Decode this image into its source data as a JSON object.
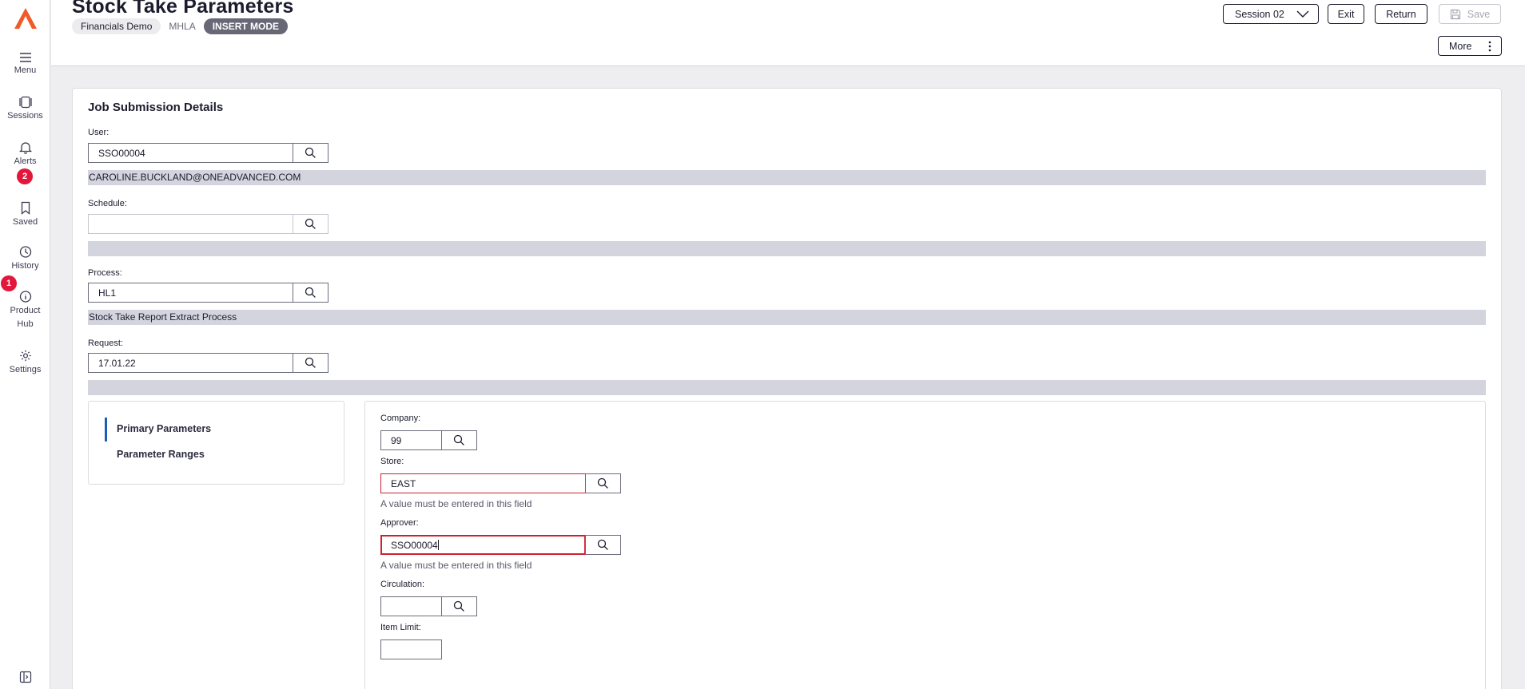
{
  "rail": {
    "items": [
      {
        "label": "Menu",
        "icon": "hamburger-icon"
      },
      {
        "label": "Sessions",
        "icon": "sessions-icon"
      },
      {
        "label": "Alerts",
        "icon": "bell-icon",
        "badge": "2"
      },
      {
        "label": "Saved",
        "icon": "bookmark-icon"
      },
      {
        "label": "History",
        "icon": "clock-icon"
      },
      {
        "label": "Product",
        "label2": "Hub",
        "icon": "info-icon",
        "badge": "1"
      },
      {
        "label": "Settings",
        "icon": "gear-icon"
      }
    ],
    "brand_color": "#f05a28"
  },
  "header": {
    "title": "Stock Take Parameters",
    "chips": [
      "Financials Demo",
      "MHLA",
      "INSERT MODE"
    ],
    "session_label": "Session 02",
    "exit_label": "Exit",
    "return_label": "Return",
    "save_label": "Save",
    "more_label": "More"
  },
  "job": {
    "section_title": "Job Submission Details",
    "user": {
      "label": "User:",
      "value": "SSO00004",
      "description": "CAROLINE.BUCKLAND@ONEADVANCED.COM"
    },
    "schedule": {
      "label": "Schedule:",
      "value": "",
      "description": ""
    },
    "process": {
      "label": "Process:",
      "value": "HL1",
      "description": "Stock Take Report Extract Process"
    },
    "request": {
      "label": "Request:",
      "value": "17.01.22",
      "description": ""
    }
  },
  "tabs": {
    "primary": "Primary Parameters",
    "ranges": "Parameter Ranges"
  },
  "params": {
    "company": {
      "label": "Company:",
      "value": "99"
    },
    "store": {
      "label": "Store:",
      "value": "EAST",
      "error": "A value must be entered in this field"
    },
    "approver": {
      "label": "Approver:",
      "value": "SSO00004",
      "error": "A value must be entered in this field"
    },
    "circulation": {
      "label": "Circulation:",
      "value": ""
    },
    "item_limit": {
      "label": "Item Limit:",
      "value": ""
    }
  },
  "colors": {
    "error": "#d0202f",
    "badge": "#e3163b",
    "desc_bar": "#d4d4de",
    "accent": "#1a5fb4"
  }
}
